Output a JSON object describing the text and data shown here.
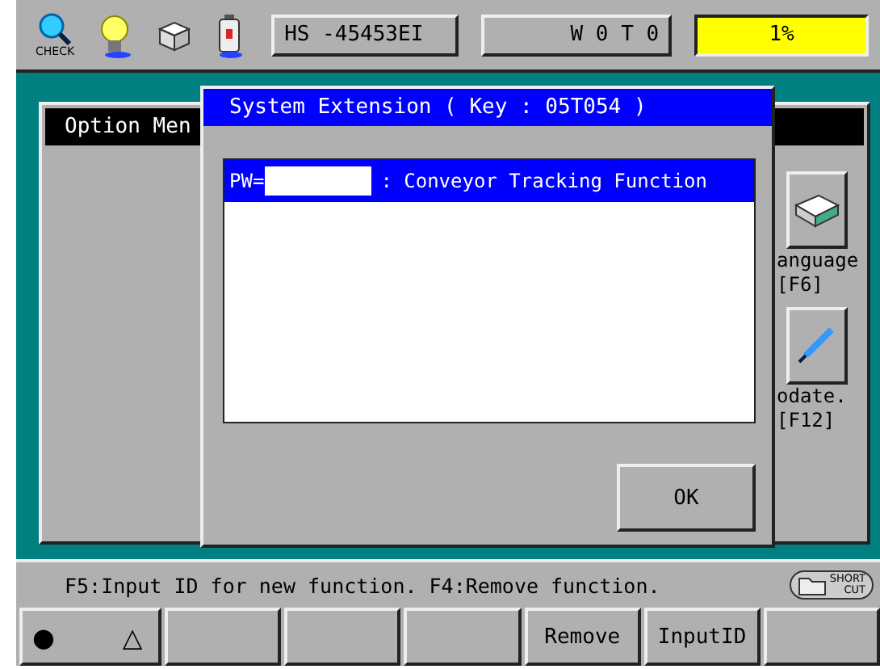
{
  "toolbar": {
    "check_label": "CHECK",
    "robot_id": "HS -45453EI",
    "status": "W 0 T 0",
    "progress_reading": "1%"
  },
  "background_window": {
    "title": "Option Men",
    "items": [
      {
        "label": "anguage",
        "key": "[F6]",
        "kind": "keyboard"
      },
      {
        "label": "odate.",
        "key": "[F12]",
        "kind": "pen"
      }
    ]
  },
  "dialog": {
    "title": "System Extension ( Key : 05T054 )",
    "rows": [
      {
        "prefix": "PW=",
        "name": ": Conveyor Tracking Function",
        "selected": true
      }
    ],
    "ok_button": "OK"
  },
  "message": "F5:Input ID for new function. F4:Remove function.",
  "shortcut": {
    "line1": "SHORT",
    "line2": "CUT"
  },
  "function_keys": [
    {
      "kind": "symbols",
      "symbols": [
        "●",
        "△"
      ]
    },
    {
      "kind": "blank"
    },
    {
      "kind": "blank"
    },
    {
      "kind": "blank"
    },
    {
      "kind": "label",
      "label": "Remove"
    },
    {
      "kind": "label",
      "label": "InputID"
    },
    {
      "kind": "blank"
    }
  ]
}
